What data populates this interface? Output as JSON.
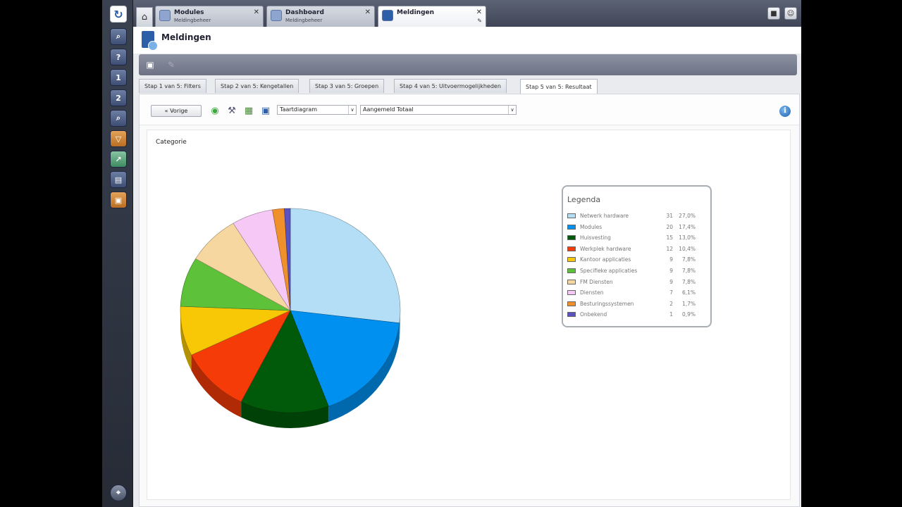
{
  "tabs": [
    {
      "title": "Modules",
      "subtitle": "Meldingbeheer"
    },
    {
      "title": "Dashboard",
      "subtitle": "Meldingbeheer"
    },
    {
      "title": "Meldingen",
      "subtitle": ""
    }
  ],
  "page_title": "Meldingen",
  "steps": [
    "Stap 1 van 5: Filters",
    "Stap 2 van 5: Kengetallen",
    "Stap 3 van 5: Groepen",
    "Stap 4 van 5: Uitvoermogelijkheden",
    "Stap 5 van 5: Resultaat"
  ],
  "active_step": 4,
  "controls": {
    "prev_label": "« Vorige",
    "chart_type": "Taartdiagram",
    "measure": "Aangemeld Totaal"
  },
  "chart_data": {
    "type": "pie",
    "title": "Categorie",
    "legend_title": "Legenda",
    "legend_position": "right",
    "slices": [
      {
        "label": "Netwerk hardware",
        "count": 31,
        "percent": "27,0%",
        "color": "#b3def5"
      },
      {
        "label": "Modules",
        "count": 20,
        "percent": "17,4%",
        "color": "#0090f0"
      },
      {
        "label": "Huisvesting",
        "count": 15,
        "percent": "13,0%",
        "color": "#005a0a"
      },
      {
        "label": "Werkplek hardware",
        "count": 12,
        "percent": "10,4%",
        "color": "#f53b07"
      },
      {
        "label": "Kantoor applicaties",
        "count": 9,
        "percent": "7,8%",
        "color": "#f8c806"
      },
      {
        "label": "Specifieke applicaties",
        "count": 9,
        "percent": "7,8%",
        "color": "#5dc23a"
      },
      {
        "label": "FM Diensten",
        "count": 9,
        "percent": "7,8%",
        "color": "#f5d79f"
      },
      {
        "label": "Diensten",
        "count": 7,
        "percent": "6,1%",
        "color": "#f6c8f6"
      },
      {
        "label": "Besturingssystemen",
        "count": 2,
        "percent": "1,7%",
        "color": "#f0902a"
      },
      {
        "label": "Onbekend",
        "count": 1,
        "percent": "0,9%",
        "color": "#5a52c0"
      }
    ]
  }
}
